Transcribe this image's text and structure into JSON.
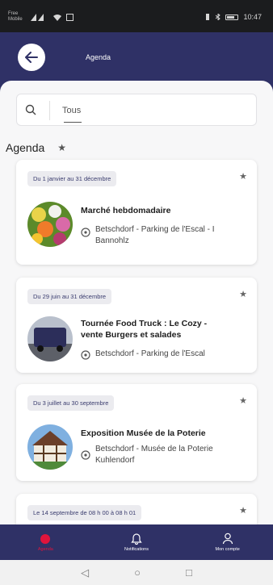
{
  "status_bar": {
    "carrier": "Free\nMobile",
    "right_text": "10:47"
  },
  "header": {
    "title": "Agenda"
  },
  "search": {
    "value": "Tous"
  },
  "section": {
    "title": "Agenda"
  },
  "events": [
    {
      "date": "Du 1 janvier au 31 décembre",
      "title": "Marché hebdomadaire",
      "location": "Betschdorf - Parking de l'Escal - I\nBannohlz"
    },
    {
      "date": "Du 29 juin au 31 décembre",
      "title": "Tournée Food Truck : Le Cozy -\nvente Burgers et salades",
      "location": "Betschdorf - Parking de l'Escal"
    },
    {
      "date": "Du 3 juillet au 30 septembre",
      "title": "Exposition Musée de la Poterie",
      "location": "Betschdorf - Musée de la Poterie\nKuhlendorf"
    },
    {
      "date": "Le 14 septembre de 08 h 00 à 08 h 01",
      "title": "",
      "location": ""
    }
  ],
  "bottom_nav": [
    {
      "label": "Agenda",
      "icon": "event-icon"
    },
    {
      "label": "Notifications",
      "icon": "bell-icon"
    },
    {
      "label": "Mon compte",
      "icon": "person-icon"
    }
  ],
  "colors": {
    "primary": "#2f3166",
    "accent": "#e0143c",
    "background": "#f7f7f8"
  }
}
